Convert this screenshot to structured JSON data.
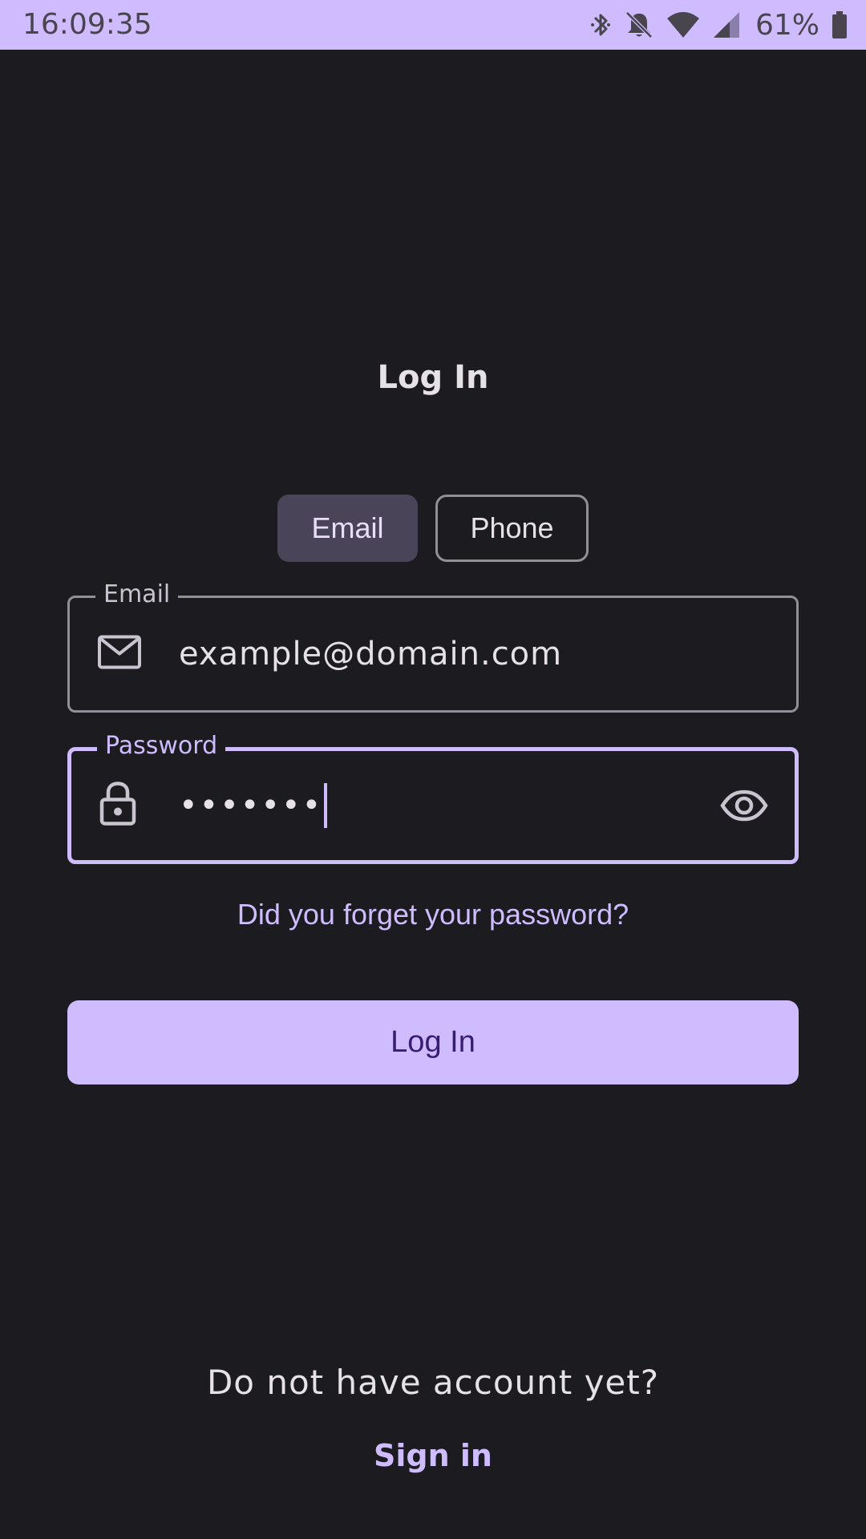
{
  "status_bar": {
    "time": "16:09:35",
    "battery_percent": "61%",
    "icons": [
      "bluetooth-icon",
      "notifications-off-icon",
      "wifi-icon",
      "cellular-signal-icon",
      "battery-icon"
    ]
  },
  "colors": {
    "background": "#1c1b1f",
    "accent": "#cfbcff",
    "on_accent": "#381e72",
    "selected_toggle": "#4a4458",
    "outline": "#938f99",
    "text": "#e6e1e5"
  },
  "header": {
    "title": "Log In"
  },
  "login_method": {
    "email_label": "Email",
    "phone_label": "Phone",
    "selected": "Email"
  },
  "email_field": {
    "label": "Email",
    "value": "example@domain.com",
    "icon": "mail-icon"
  },
  "password_field": {
    "label": "Password",
    "value": "•••••••",
    "icon": "lock-icon",
    "toggle_icon": "eye-icon"
  },
  "forgot_password": "Did you forget your password?",
  "login_button": "Log In",
  "footer": {
    "prompt": "Do not have account yet?",
    "signin_link": "Sign in"
  }
}
